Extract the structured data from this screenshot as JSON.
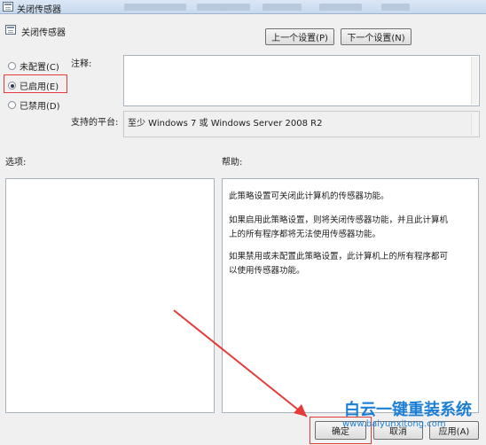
{
  "window": {
    "title": "关闭传感器",
    "header_title": "关闭传感器"
  },
  "nav": {
    "prev_label": "上一个设置(P)",
    "next_label": "下一个设置(N)"
  },
  "state": {
    "options": [
      {
        "label": "未配置(C)",
        "selected": false
      },
      {
        "label": "已启用(E)",
        "selected": true
      },
      {
        "label": "已禁用(D)",
        "selected": false
      }
    ]
  },
  "comment": {
    "label": "注释:",
    "value": ""
  },
  "platform": {
    "label": "支持的平台:",
    "value": "至少 Windows 7 或 Windows Server 2008 R2"
  },
  "sections": {
    "options_label": "选项:",
    "help_label": "帮助:"
  },
  "help": {
    "paragraphs": [
      "此策略设置可关闭此计算机的传感器功能。",
      "如果启用此策略设置，则将关闭传感器功能，并且此计算机\n上的所有程序都将无法使用传感器功能。",
      "如果禁用或未配置此策略设置，此计算机上的所有程序都可\n以使用传感器功能。"
    ]
  },
  "footer": {
    "ok_label": "确定",
    "cancel_label": "取消",
    "apply_label": "应用(A)"
  },
  "watermark": {
    "title": "白云一键重装系统",
    "url": "www.baiyunxitong.com"
  },
  "annotation_color": "#e53a3a"
}
